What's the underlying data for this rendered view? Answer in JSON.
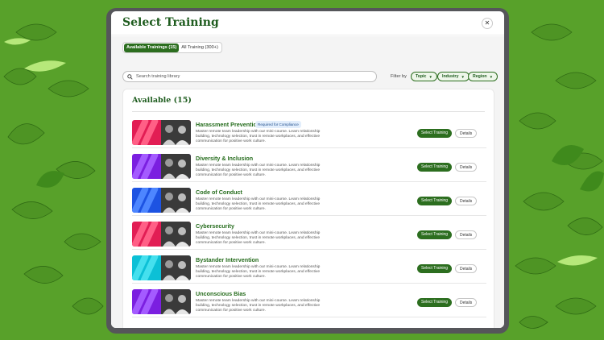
{
  "modal": {
    "title": "Select Training",
    "close_glyph": "✕",
    "tabs": [
      {
        "label": "Available Trainings (15)",
        "active": true
      },
      {
        "label": "All Training (300+)",
        "active": false
      }
    ],
    "search": {
      "placeholder": "Search training library",
      "icon": "search-icon"
    },
    "filter_label": "Filter by",
    "filters": [
      "Topic",
      "Industry",
      "Region"
    ],
    "section_title": "Available (15)",
    "select_label": "Select Training",
    "details_label": "Details",
    "trainings": [
      {
        "title": "Harassment Prevention",
        "badge": "Required for Compliance",
        "description": "Master remote team leadership with our mini-course. Learn relationship building, technology selection, trust in remote workplaces, and effective communication for positive work culture.",
        "color_a": "#e21d54",
        "color_b": "#ff5f86"
      },
      {
        "title": "Diversity & Inclusion",
        "badge": "",
        "description": "Master remote team leadership with our mini-course. Learn relationship building, technology selection, trust in remote workplaces, and effective communication for positive work culture.",
        "color_a": "#7b1fe0",
        "color_b": "#a45bff"
      },
      {
        "title": "Code of Conduct",
        "badge": "",
        "description": "Master remote team leadership with our mini-course. Learn relationship building, technology selection, trust in remote workplaces, and effective communication for positive work culture.",
        "color_a": "#1d53e2",
        "color_b": "#4d86ff"
      },
      {
        "title": "Cybersecurity",
        "badge": "",
        "description": "Master remote team leadership with our mini-course. Learn relationship building, technology selection, trust in remote workplaces, and effective communication for positive work culture.",
        "color_a": "#e21d54",
        "color_b": "#ff5f86"
      },
      {
        "title": "Bystander Intervention",
        "badge": "",
        "description": "Master remote team leadership with our mini-course. Learn relationship building, technology selection, trust in remote workplaces, and effective communication for positive work culture.",
        "color_a": "#0cc0d6",
        "color_b": "#45e0ee"
      },
      {
        "title": "Unconscious Bias",
        "badge": "",
        "description": "Master remote team leadership with our mini-course. Learn relationship building, technology selection, trust in remote workplaces, and effective communication for positive work culture.",
        "color_a": "#7b1fe0",
        "color_b": "#a45bff"
      }
    ]
  },
  "colors": {
    "brand_green": "#2c6e1f",
    "background": "#58a12a"
  }
}
